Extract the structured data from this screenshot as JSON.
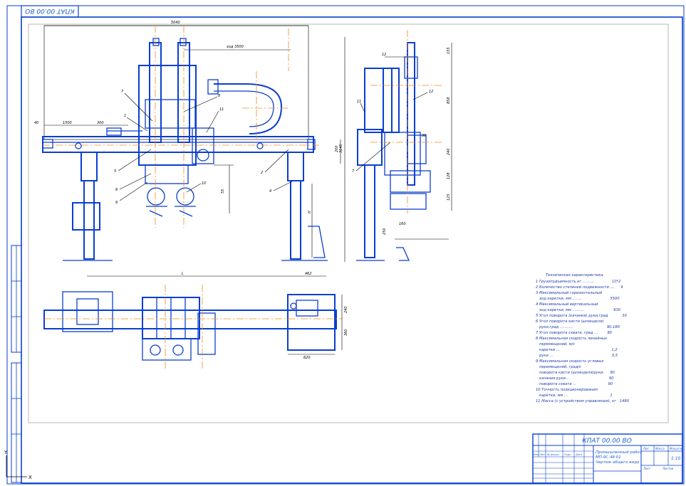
{
  "drawing": {
    "code": "КПАТ 00.00 ВО",
    "code_rotated": "КПАТ 00.00 ВО",
    "title_line1": "Промышленный робот",
    "title_line2": "МП-9С.48.01",
    "title_line3": "Чертеж общего вида",
    "scale": "1:10"
  },
  "dims": {
    "overall_width": "5040",
    "stroke_horiz": "ход 3500",
    "d1500": "1500",
    "d300": "300",
    "d40": "40",
    "d55": "55",
    "d462": "462",
    "dL": "L",
    "d200": "200",
    "d3145": "3145",
    "d155": "155",
    "d858": "858",
    "d30": "30",
    "d240": "240",
    "d128": "128",
    "d125": "125",
    "d160": "160",
    "d250": "250",
    "d240b": "240",
    "d360": "360",
    "d620": "620",
    "dH": "H"
  },
  "callouts": [
    "1",
    "2",
    "3",
    "4",
    "5",
    "6",
    "7",
    "8",
    "9",
    "10",
    "11",
    "12"
  ],
  "specs": {
    "heading": "Техническая характеристика",
    "lines": [
      "1 Грузоподъемность,кг ..........               10*2",
      "2 Количество степеней подвижности ....     9",
      "3 Максимальный горизонтальный",
      "   ход каретки, мм ........                        3500",
      "4 Максимальный вертикальный",
      "   ход каретки, мм ..........                         630",
      "5 Угол поворота (качания) руки,град            30",
      "6 Угол поворота кисти (шпинделя)",
      "   руки,град ...........                             90,180",
      "7 Угол поворота схвата, град ...        90",
      "8 Максимальная скорость линейных",
      "   перемещений, м/с",
      "   каретки ...                                            1,2",
      "   руки ...                                                  0,5",
      "9 Максимальная скорость угловых",
      "   перемещений, град/с",
      "   поворота кисти (шпинделя)руки.     90",
      "   качания руки...                                  90",
      "   поворота схвата ...                           90",
      "10 Точность позиционирования",
      "   каретки, мм ...                                    1",
      "11 Масса (с устройством управления), кг   1480"
    ]
  },
  "stamp_cols": [
    "Изм",
    "Лист",
    "№ докум.",
    "Подп.",
    "Дата"
  ],
  "stamp_right": [
    "Лит",
    "Масса",
    "Масштаб"
  ],
  "sheet_label": "Лист",
  "sheets_label": "Листов"
}
